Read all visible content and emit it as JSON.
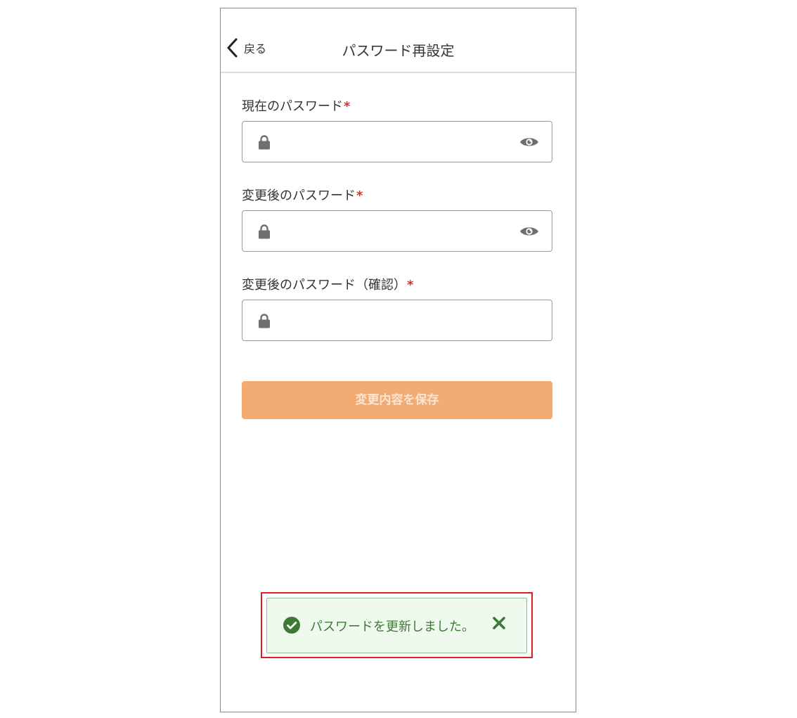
{
  "header": {
    "back_label": "戻る",
    "title": "パスワード再設定"
  },
  "fields": [
    {
      "label": "現在のパスワード",
      "required_mark": "*",
      "value": "",
      "icon": "lock-icon",
      "toggle_icon": "eye-icon"
    },
    {
      "label": "変更後のパスワード",
      "required_mark": "*",
      "value": "",
      "icon": "lock-icon",
      "toggle_icon": "eye-icon"
    },
    {
      "label": "変更後のパスワード（確認）",
      "required_mark": "*",
      "value": "",
      "icon": "lock-icon"
    }
  ],
  "save_button": {
    "label": "変更内容を保存",
    "state": "disabled"
  },
  "toast": {
    "message": "パスワードを更新しました。",
    "icon": "check-circle-icon",
    "close_icon": "close-icon",
    "type": "success"
  },
  "colors": {
    "required": "#d6332e",
    "button_bg": "#f2ab72",
    "toast_bg": "#eefaee",
    "toast_text": "#3d7a35",
    "highlight_frame": "#d92020"
  }
}
